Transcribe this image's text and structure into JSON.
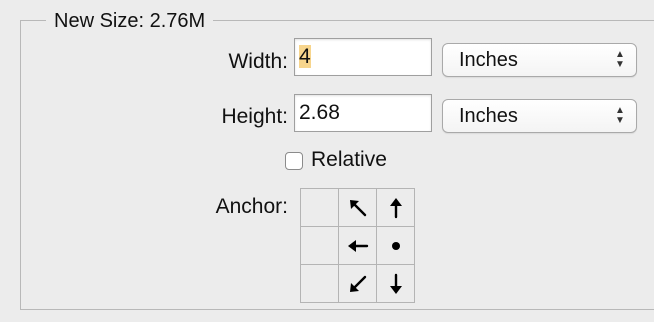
{
  "dialog": {
    "group_title": "New Size: 2.76M",
    "width_label": "Width:",
    "width_value": "4",
    "width_unit": "Inches",
    "height_label": "Height:",
    "height_value": "2.68",
    "height_unit": "Inches",
    "relative_label": "Relative",
    "relative_checked": false,
    "anchor_label": "Anchor:",
    "anchor_cells": [
      "empty-icon",
      "arrow-up-left-icon",
      "arrow-up-icon",
      "empty-icon",
      "arrow-left-icon",
      "center-dot-icon",
      "empty-icon",
      "arrow-down-left-icon",
      "arrow-down-icon"
    ]
  },
  "colors": {
    "background": "#ececec",
    "border": "#b8b8b8",
    "selection_highlight": "#f7d58d"
  }
}
